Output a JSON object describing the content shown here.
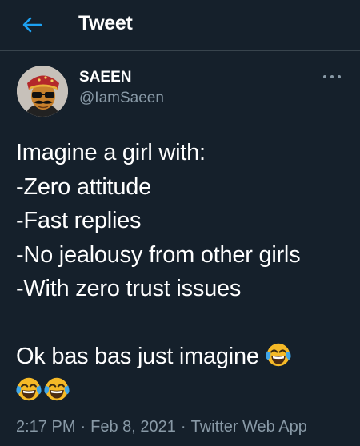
{
  "header": {
    "title": "Tweet",
    "back_icon": "arrow-left-icon",
    "accent_color": "#1da1f2"
  },
  "tweet": {
    "author": {
      "display_name": "SAEEN",
      "handle": "@IamSaeen",
      "avatar_icon": "avatar-cartoon-man"
    },
    "more_icon": "more-horizontal-icon",
    "lines": [
      "Imagine a girl with:",
      "-Zero attitude",
      "-Fast replies",
      "-No jealousy from other girls",
      "-With zero trust issues"
    ],
    "closing_text": "Ok bas bas just imagine",
    "emoji_name": "face-with-tears-of-joy",
    "time": "2:17 PM",
    "date": "Feb 8, 2021",
    "source": "Twitter Web App",
    "separator": "·"
  },
  "colors": {
    "background": "#15202b",
    "text": "#ffffff",
    "secondary_text": "#8899a6",
    "divider": "#38444d"
  }
}
